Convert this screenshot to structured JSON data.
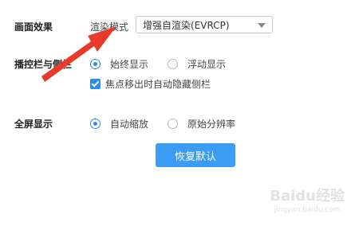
{
  "sections": {
    "picture_effect": {
      "title": "画面效果",
      "render_mode_label": "渲染模式",
      "render_mode_select": {
        "value": "增强自渲染(EVRCP)"
      }
    },
    "playbar": {
      "title": "播控栏与侧栏",
      "options": [
        "始终显示",
        "浮动显示"
      ],
      "selected_index": 0,
      "auto_hide_checkbox": {
        "label": "焦点移出时自动隐藏侧栏",
        "checked": true
      }
    },
    "fullscreen": {
      "title": "全屏显示",
      "options": [
        "自动缩放",
        "原始分辨率"
      ],
      "selected_index": 0
    }
  },
  "reset_button": {
    "label": "恢复默认"
  },
  "annotation_arrow": {
    "color": "#e8392b"
  },
  "watermark": {
    "main": "Baidu经验",
    "sub": "jingyan.baidu.com"
  },
  "colors": {
    "accent": "#2b8cf0",
    "button": "#3a9cf5"
  }
}
